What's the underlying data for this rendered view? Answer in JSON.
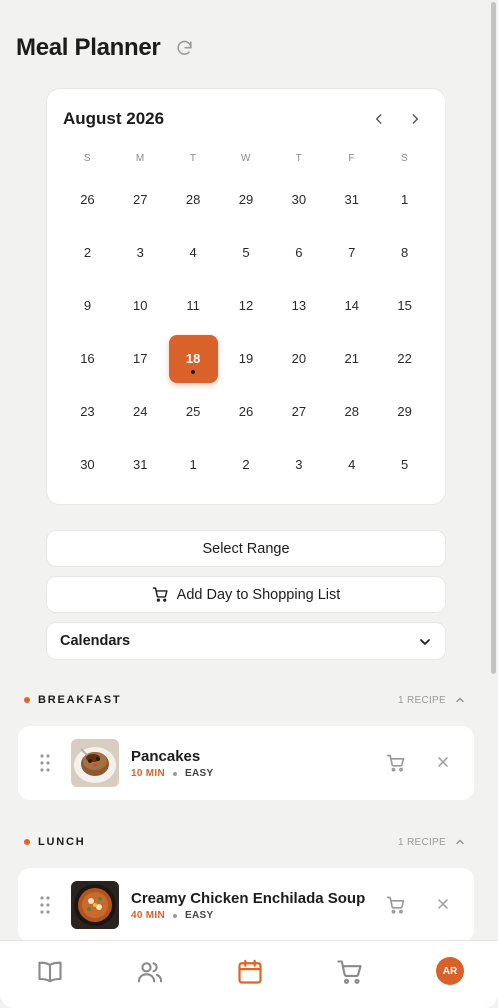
{
  "header": {
    "title": "Meal Planner",
    "refresh_icon": "refresh-icon"
  },
  "calendar": {
    "month_label": "August 2026",
    "weekdays": [
      "S",
      "M",
      "T",
      "W",
      "T",
      "F",
      "S"
    ],
    "weeks": [
      [
        "26",
        "27",
        "28",
        "29",
        "30",
        "31",
        "1"
      ],
      [
        "2",
        "3",
        "4",
        "5",
        "6",
        "7",
        "8"
      ],
      [
        "9",
        "10",
        "11",
        "12",
        "13",
        "14",
        "15"
      ],
      [
        "16",
        "17",
        "18",
        "19",
        "20",
        "21",
        "22"
      ],
      [
        "23",
        "24",
        "25",
        "26",
        "27",
        "28",
        "29"
      ],
      [
        "30",
        "31",
        "1",
        "2",
        "3",
        "4",
        "5"
      ]
    ],
    "selected_day": "18",
    "accent_color": "#d9622b"
  },
  "actions": {
    "select_range_label": "Select Range",
    "add_day_label": "Add Day to Shopping List",
    "calendars_label": "Calendars"
  },
  "sections": [
    {
      "title": "BREAKFAST",
      "count": "1 RECIPE",
      "recipes": [
        {
          "name": "Pancakes",
          "time": "10 MIN",
          "difficulty": "EASY"
        }
      ]
    },
    {
      "title": "LUNCH",
      "count": "1 RECIPE",
      "recipes": [
        {
          "name": "Creamy Chicken Enchilada Soup",
          "time": "40 MIN",
          "difficulty": "EASY"
        }
      ]
    }
  ],
  "tabbar": {
    "icons": [
      "book-icon",
      "people-icon",
      "calendar-icon",
      "cart-icon"
    ],
    "active": "calendar-icon",
    "avatar_initials": "AR"
  }
}
